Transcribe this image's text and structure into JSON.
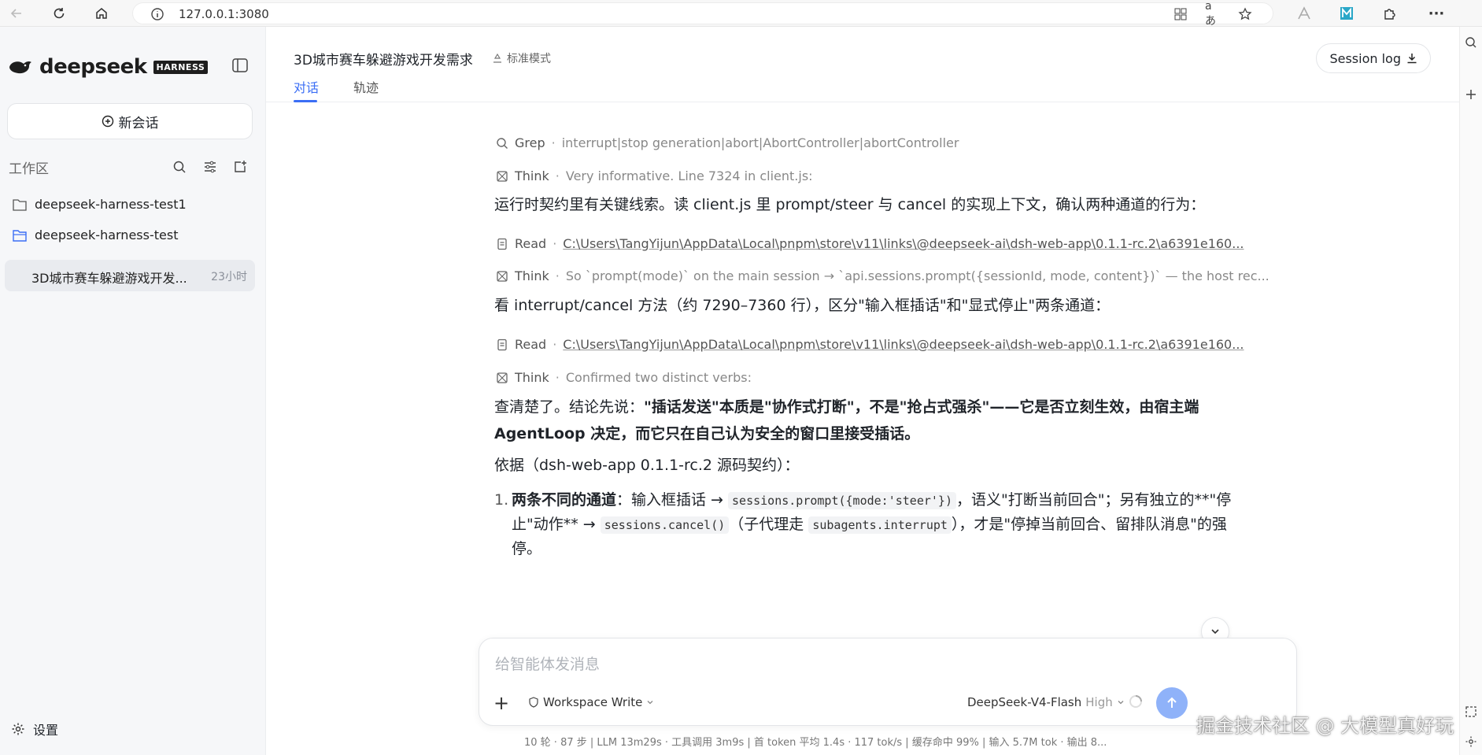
{
  "browser": {
    "url": "127.0.0.1:3080"
  },
  "sidebar": {
    "brand": "deepseek",
    "badge": "HARNESS",
    "new_chat": "新会话",
    "workspace_label": "工作区",
    "projects": [
      {
        "name": "deepseek-harness-test1"
      },
      {
        "name": "deepseek-harness-test"
      }
    ],
    "session": {
      "title": "3D城市赛车躲避游戏开发...",
      "time": "23小时"
    },
    "settings": "设置"
  },
  "header": {
    "title": "3D城市赛车躲避游戏开发需求",
    "mode": "标准模式",
    "tabs": [
      {
        "label": "对话"
      },
      {
        "label": "轨迹"
      }
    ],
    "session_log": "Session log"
  },
  "conversation": {
    "tool1": {
      "name": "Grep",
      "arg": "interrupt|stop generation|abort|AbortController|abortController"
    },
    "tool2": {
      "name": "Think",
      "arg": "Very informative. Line 7324 in client.js:"
    },
    "p1": "运行时契约里有关键线索。读 client.js 里 prompt/steer 与 cancel 的实现上下文，确认两种通道的行为：",
    "tool3": {
      "name": "Read",
      "arg": "C:\\Users\\TangYijun\\AppData\\Local\\pnpm\\store\\v11\\links\\@deepseek-ai\\dsh-web-app\\0.1.1-rc.2\\a6391e160..."
    },
    "tool4": {
      "name": "Think",
      "arg": "So `prompt(mode)` on the main session → `api.sessions.prompt({sessionId, mode, content})` — the host rec..."
    },
    "p2": "看 interrupt/cancel 方法（约 7290–7360 行），区分\"输入框插话\"和\"显式停止\"两条通道：",
    "tool5": {
      "name": "Read",
      "arg": "C:\\Users\\TangYijun\\AppData\\Local\\pnpm\\store\\v11\\links\\@deepseek-ai\\dsh-web-app\\0.1.1-rc.2\\a6391e160..."
    },
    "tool6": {
      "name": "Think",
      "arg": "Confirmed two distinct verbs:"
    },
    "p3_prefix": "查清楚了。结论先说：",
    "p3_bold": "\"插话发送\"本质是\"协作式打断\"，不是\"抢占式强杀\"——它是否立刻生效，由宿主端 AgentLoop 决定，而它只在自己认为安全的窗口里接受插话。",
    "p4": "依据（dsh-web-app 0.1.1-rc.2 源码契约）：",
    "li_num": "1.",
    "li_bold": "两条不同的通道",
    "li_t1": "：输入框插话 → ",
    "li_code1": "sessions.prompt({mode:'steer'})",
    "li_t2": "，语义\"打断当前回合\"；另有独立的**\"停止\"动作** → ",
    "li_code2": "sessions.cancel()",
    "li_t3": "（子代理走 ",
    "li_code3": "subagents.interrupt",
    "li_t4": "），才是\"停掉当前回合、留排队消息\"的强停。"
  },
  "composer": {
    "placeholder": "给智能体发消息",
    "workspace": "Workspace Write",
    "model": "DeepSeek-V4-Flash",
    "effort": "High"
  },
  "stats": "10 轮 · 87 步  |  LLM 13m29s · 工具调用 3m9s  |  首 token 平均 1.4s · 117 tok/s  |  缓存命中 99%  |  输入 5.7M tok · 输出 8...",
  "watermark": "掘金技术社区 @ 大模型真好玩"
}
